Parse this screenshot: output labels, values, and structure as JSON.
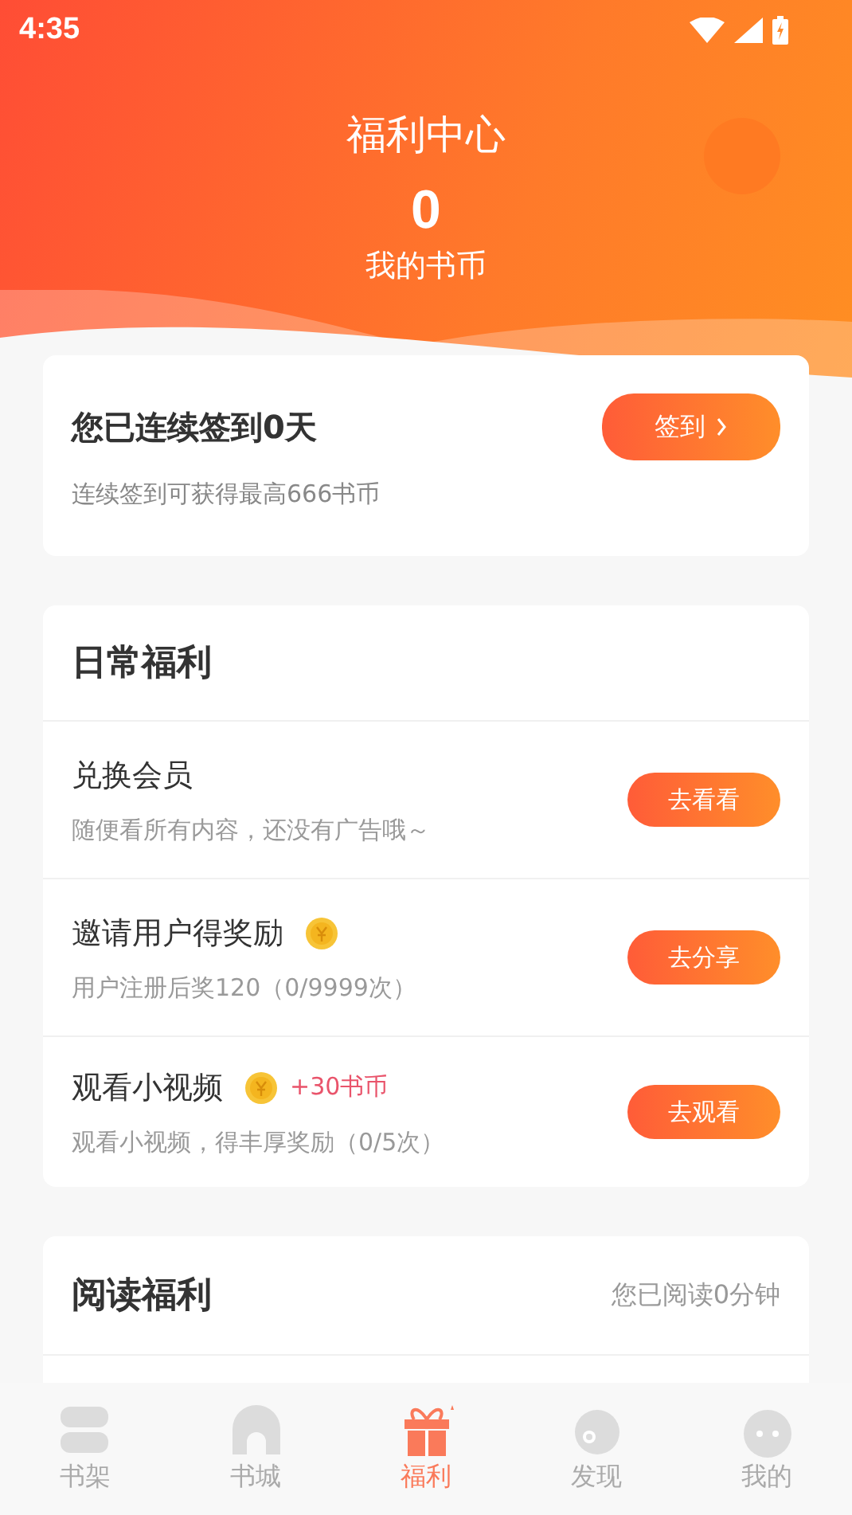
{
  "status_bar": {
    "time": "4:35"
  },
  "header": {
    "title": "福利中心",
    "coins": "0",
    "coins_label": "我的书币"
  },
  "checkin": {
    "title": "您已连续签到0天",
    "subtitle": "连续签到可获得最高666书币",
    "button": "签到"
  },
  "daily": {
    "title": "日常福利",
    "items": [
      {
        "title": "兑换会员",
        "coin": false,
        "desc": "随便看所有内容，还没有广告哦～",
        "button": "去看看"
      },
      {
        "title": "邀请用户得奖励",
        "coin": true,
        "desc": "用户注册后奖120（0/9999次）",
        "button": "去分享"
      },
      {
        "title": "观看小视频",
        "coin": true,
        "reward": "+30书币",
        "desc": "观看小视频，得丰厚奖励（0/5次）",
        "button": "去观看"
      }
    ]
  },
  "reading": {
    "title": "阅读福利",
    "status": "您已阅读0分钟"
  },
  "nav": [
    {
      "label": "书架",
      "kind": "shelf",
      "selected": false
    },
    {
      "label": "书城",
      "kind": "store",
      "selected": false
    },
    {
      "label": "福利",
      "kind": "gift",
      "selected": true
    },
    {
      "label": "发现",
      "kind": "discover",
      "selected": false
    },
    {
      "label": "我的",
      "kind": "me",
      "selected": false
    }
  ]
}
